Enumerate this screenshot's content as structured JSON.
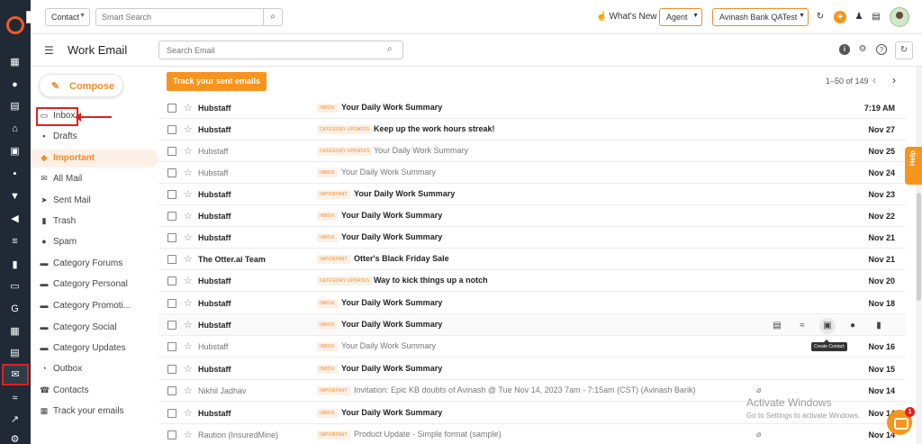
{
  "topbar": {
    "context_select": "Contact",
    "smart_search_placeholder": "Smart Search",
    "whats_new": "What's New",
    "agent_select": "Agent",
    "user_select": "Avinash Barik QATest"
  },
  "header": {
    "title": "Work Email",
    "search_placeholder": "Search Email"
  },
  "sidebar": {
    "compose_label": "Compose",
    "items": [
      {
        "label": "Inbox",
        "icon": "inbox-icon"
      },
      {
        "label": "Drafts",
        "icon": "draft-icon"
      },
      {
        "label": "Important",
        "icon": "tag-icon"
      },
      {
        "label": "All Mail",
        "icon": "mail-icon"
      },
      {
        "label": "Sent Mail",
        "icon": "send-icon"
      },
      {
        "label": "Trash",
        "icon": "trash-icon"
      },
      {
        "label": "Spam",
        "icon": "spam-icon"
      },
      {
        "label": "Category Forums",
        "icon": "folder-icon"
      },
      {
        "label": "Category Personal",
        "icon": "folder-icon"
      },
      {
        "label": "Category Promoti...",
        "icon": "folder-icon"
      },
      {
        "label": "Category Social",
        "icon": "folder-icon"
      },
      {
        "label": "Category Updates",
        "icon": "folder-icon"
      },
      {
        "label": "Outbox",
        "icon": "outbox-icon"
      },
      {
        "label": "Contacts",
        "icon": "contacts-icon"
      },
      {
        "label": "Track your emails",
        "icon": "track-icon"
      }
    ]
  },
  "main": {
    "track_button": "Track your sent emails",
    "pager": "1–50 of 149",
    "rows": [
      {
        "sender": "Hubstaff",
        "tag": "INBOX",
        "subject": "Your Daily Work Summary",
        "date": "7:19 AM",
        "read": false
      },
      {
        "sender": "Hubstaff",
        "tag": "CATEGORY UPDATES",
        "subject": "Keep up the work hours streak!",
        "date": "Nov 27",
        "read": false
      },
      {
        "sender": "Hubstaff",
        "tag": "CATEGORY UPDATES",
        "subject": "Your Daily Work Summary",
        "date": "Nov 25",
        "read": true
      },
      {
        "sender": "Hubstaff",
        "tag": "INBOX",
        "subject": "Your Daily Work Summary",
        "date": "Nov 24",
        "read": true
      },
      {
        "sender": "Hubstaff",
        "tag": "IMPORTANT",
        "subject": "Your Daily Work Summary",
        "date": "Nov 23",
        "read": false
      },
      {
        "sender": "Hubstaff",
        "tag": "INBOX",
        "subject": "Your Daily Work Summary",
        "date": "Nov 22",
        "read": false
      },
      {
        "sender": "Hubstaff",
        "tag": "INBOX",
        "subject": "Your Daily Work Summary",
        "date": "Nov 21",
        "read": false
      },
      {
        "sender": "The Otter.ai Team",
        "tag": "IMPORTANT",
        "subject": "Otter's Black Friday Sale",
        "date": "Nov 21",
        "read": false
      },
      {
        "sender": "Hubstaff",
        "tag": "CATEGORY UPDATES",
        "subject": "Way to kick things up a notch",
        "date": "Nov 20",
        "read": false
      },
      {
        "sender": "Hubstaff",
        "tag": "INBOX",
        "subject": "Your Daily Work Summary",
        "date": "Nov 18",
        "read": false
      },
      {
        "sender": "Hubstaff",
        "tag": "INBOX",
        "subject": "Your Daily Work Summary",
        "date": "",
        "read": false
      },
      {
        "sender": "Hubstaff",
        "tag": "INBOX",
        "subject": "Your Daily Work Summary",
        "date": "Nov 16",
        "read": true
      },
      {
        "sender": "Hubstaff",
        "tag": "INBOX",
        "subject": "Your Daily Work Summary",
        "date": "Nov 15",
        "read": false
      },
      {
        "sender": "Nikhil Jadhav",
        "tag": "IMPORTANT",
        "subject": "Invitation: Epic KB doubts of Avinash @ Tue Nov 14, 2023 7am - 7:15am (CST) (Avinash Barik)",
        "date": "Nov 14",
        "read": true
      },
      {
        "sender": "Hubstaff",
        "tag": "INBOX",
        "subject": "Your Daily Work Summary",
        "date": "Nov 14",
        "read": false
      },
      {
        "sender": "Raution (InsuredMine)",
        "tag": "IMPORTANT",
        "subject": "Product Update - Simple format (sample)",
        "date": "Nov 14",
        "read": true
      }
    ],
    "tooltip": "Create Contact"
  },
  "help_tab": "Help",
  "watermark": {
    "line1": "Activate Windows",
    "line2": "Go to Settings to activate Windows."
  },
  "chat_badge": "1",
  "colors": {
    "accent": "#f7941d",
    "rail": "#1f2a36",
    "annotation": "#e02020"
  }
}
